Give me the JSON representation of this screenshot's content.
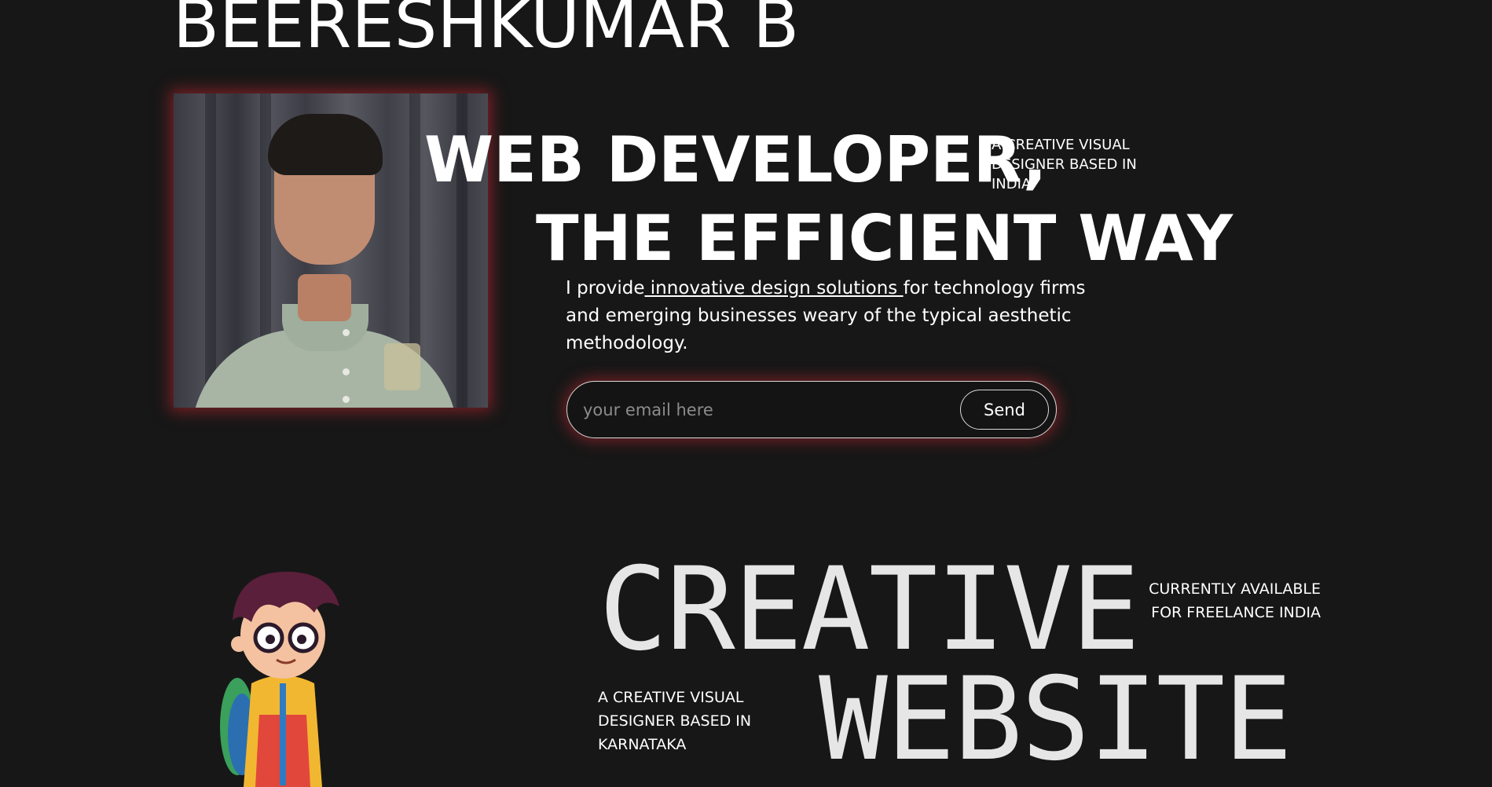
{
  "header": {
    "name": "BEERESHKUMAR B"
  },
  "hero": {
    "photo_icon": "profile-photo",
    "headline_line1": "WEB DEVELOPER,",
    "headline_line2": "THE EFFICIENT WAY",
    "tagline": "A CREATIVE VISUAL DESIGNER BASED IN INDIA",
    "intro_before": "I provide",
    "intro_link": " innovative design solutions ",
    "intro_after": "for technology firms and emerging businesses weary of the typical aesthetic methodology."
  },
  "subscribe": {
    "placeholder": "your email here",
    "value": "",
    "button_label": "Send"
  },
  "showcase": {
    "word1": "CREATIVE",
    "word2": "WEBSITE",
    "availability": "CURRENTLY AVAILABLE FOR FREELANCE INDIA",
    "tagline": "A CREATIVE VISUAL DESIGNER BASED IN KARNATAKA",
    "character_icon": "cartoon-boy-illustration"
  },
  "colors": {
    "background": "#171717",
    "text": "#ffffff",
    "glow": "#c42832",
    "display_text": "#e6e6e6"
  }
}
